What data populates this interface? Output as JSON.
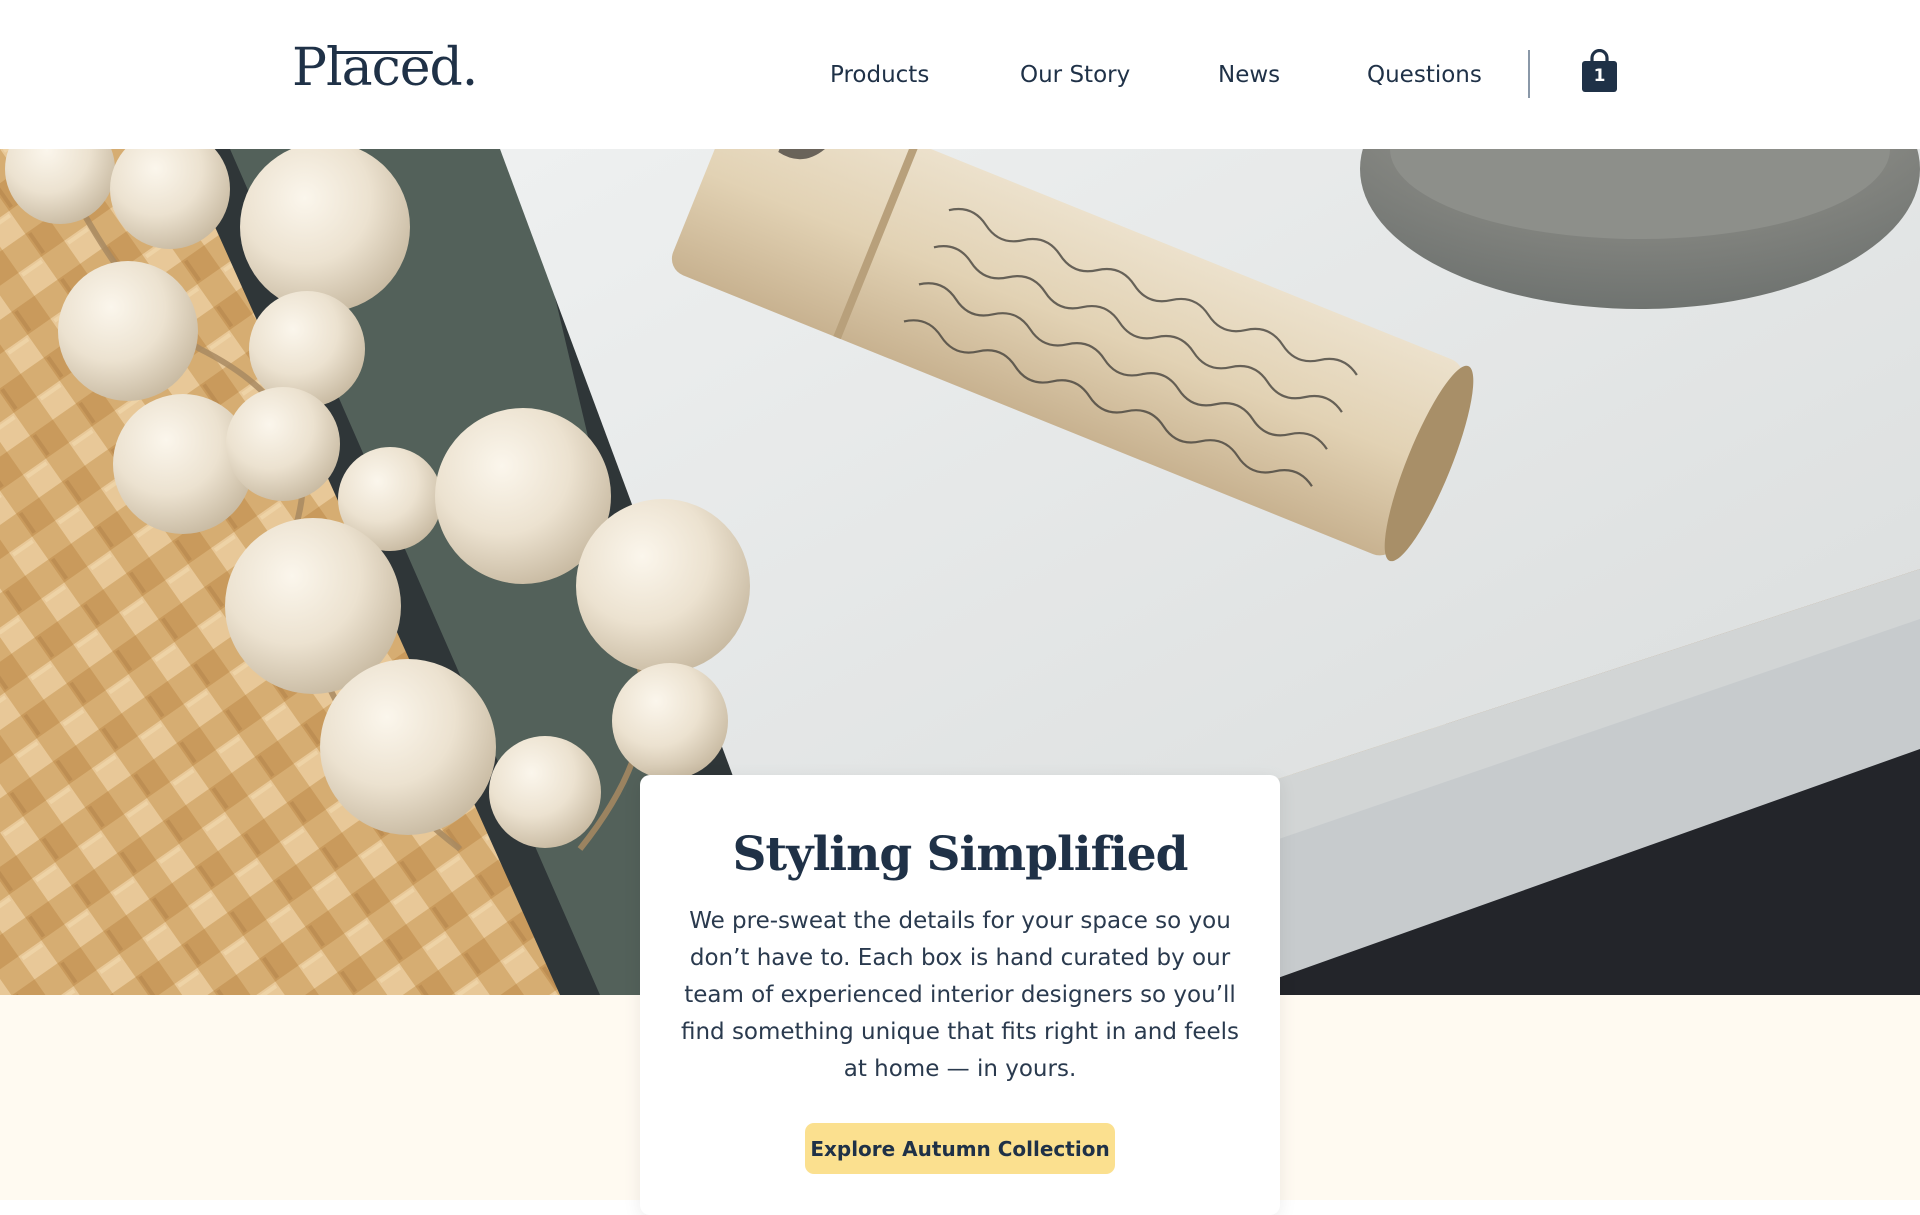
{
  "brand": {
    "logo_text": "Placed."
  },
  "nav": {
    "items": [
      {
        "label": "Products"
      },
      {
        "label": "Our Story"
      },
      {
        "label": "News"
      },
      {
        "label": "Questions"
      }
    ]
  },
  "cart": {
    "count": "1",
    "icon": "shopping-bag-icon"
  },
  "hero": {
    "image_subject": "wooden bead garland, rolled paper, stacked books",
    "title": "Styling Simplified",
    "body": "We pre-sweat the details for your space so you don’t have to. Each box is hand curated by our team of experienced interior designers so you’ll find something unique that fits right in and feels at home — in yours.",
    "cta_label": "Explore Autumn Collection"
  },
  "colors": {
    "navy": "#1f3147",
    "cta_yellow": "#fbe08f",
    "cream_band": "#fffaf1",
    "divider": "#8a98a8"
  }
}
